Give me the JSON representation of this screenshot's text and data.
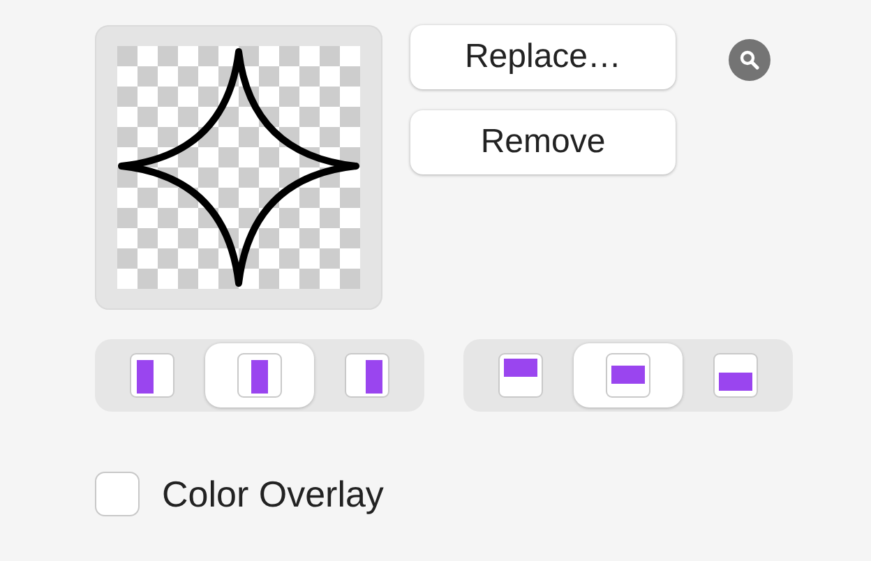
{
  "buttons": [
    {
      "label": "Replace…"
    },
    {
      "label": "Remove"
    }
  ],
  "horizontal_alignment": [
    {
      "kind": "left",
      "selected": false
    },
    {
      "kind": "center",
      "selected": true
    },
    {
      "kind": "right",
      "selected": false
    }
  ],
  "vertical_alignment": [
    {
      "kind": "top",
      "selected": false
    },
    {
      "kind": "middle",
      "selected": true
    },
    {
      "kind": "bottom",
      "selected": false
    }
  ],
  "color_overlay": {
    "label": "Color Overlay",
    "checked": false
  }
}
